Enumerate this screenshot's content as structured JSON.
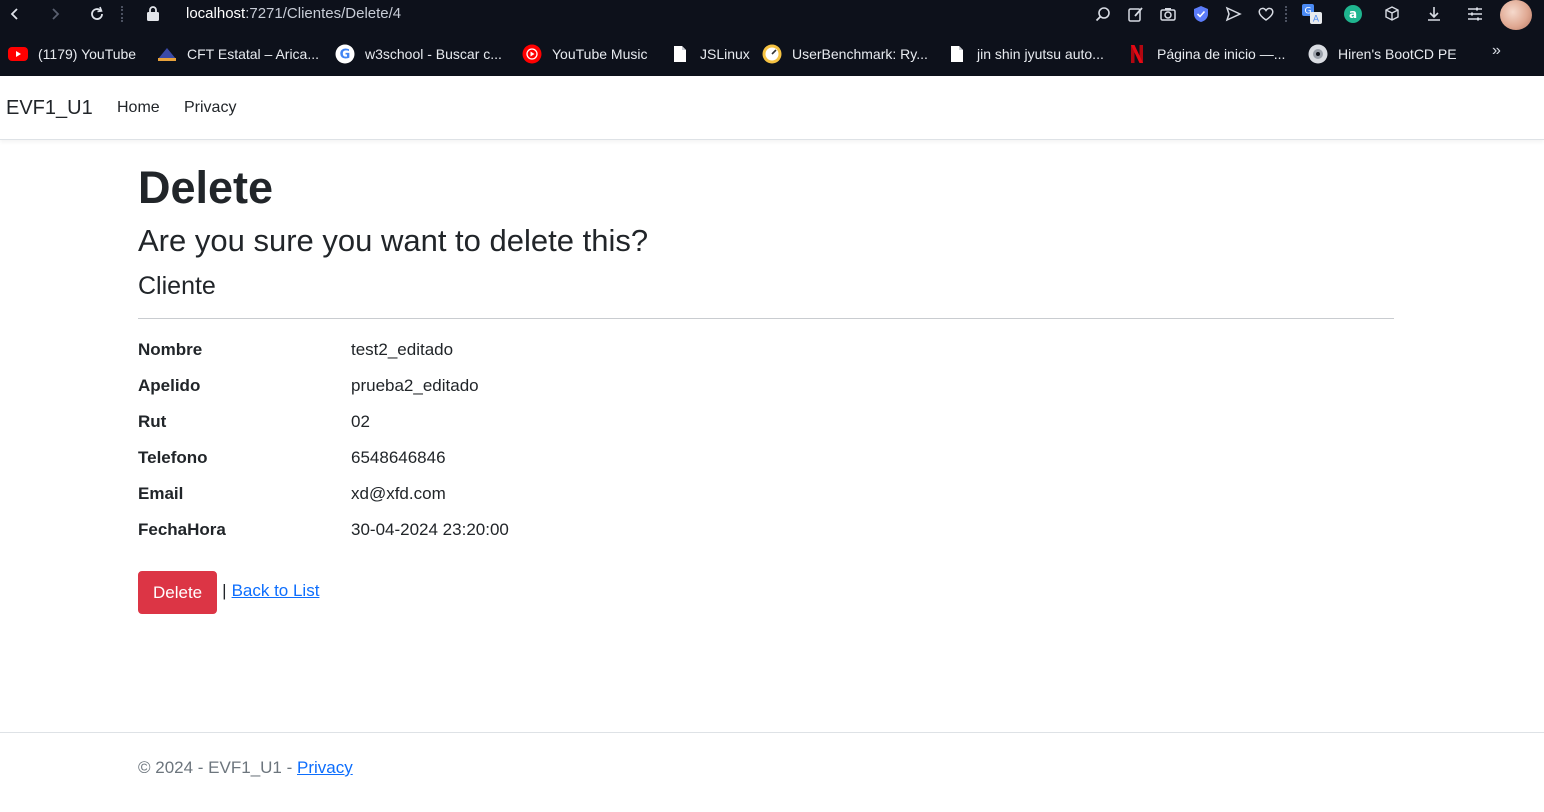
{
  "browser": {
    "url_host": "localhost",
    "url_path": ":7271/Clientes/Delete/4",
    "bookmarks": [
      {
        "label": "(1179) YouTube",
        "icon": "youtube-icon"
      },
      {
        "label": "CFT Estatal – Arica...",
        "icon": "cft-icon"
      },
      {
        "label": "w3school - Buscar c...",
        "icon": "google-icon"
      },
      {
        "label": "YouTube Music",
        "icon": "youtube-music-icon"
      },
      {
        "label": "JSLinux",
        "icon": "document-icon"
      },
      {
        "label": "UserBenchmark: Ry...",
        "icon": "userbenchmark-icon"
      },
      {
        "label": "jin shin jyutsu auto...",
        "icon": "document-icon"
      },
      {
        "label": "Página de inicio —...",
        "icon": "netflix-icon"
      },
      {
        "label": "Hiren's BootCD PE",
        "icon": "disc-icon"
      }
    ],
    "colors": {
      "chrome_bg": "#0d111b",
      "youtube": "#ff0000",
      "netflix": "#e50914"
    }
  },
  "navbar": {
    "brand": "EVF1_U1",
    "links": [
      "Home",
      "Privacy"
    ]
  },
  "page": {
    "title": "Delete",
    "question": "Are you sure you want to delete this?",
    "entity": "Cliente",
    "fields": [
      {
        "label": "Nombre",
        "value": "test2_editado"
      },
      {
        "label": "Apelido",
        "value": "prueba2_editado"
      },
      {
        "label": "Rut",
        "value": "02"
      },
      {
        "label": "Telefono",
        "value": "6548646846"
      },
      {
        "label": "Email",
        "value": "xd@xfd.com"
      },
      {
        "label": "FechaHora",
        "value": "30-04-2024 23:20:00"
      }
    ],
    "delete_label": "Delete",
    "separator": "|",
    "back_label": "Back to List",
    "colors": {
      "danger": "#dc3545",
      "link": "#0d6efd"
    }
  },
  "footer": {
    "text": "© 2024 - EVF1_U1 - ",
    "privacy_label": "Privacy"
  }
}
